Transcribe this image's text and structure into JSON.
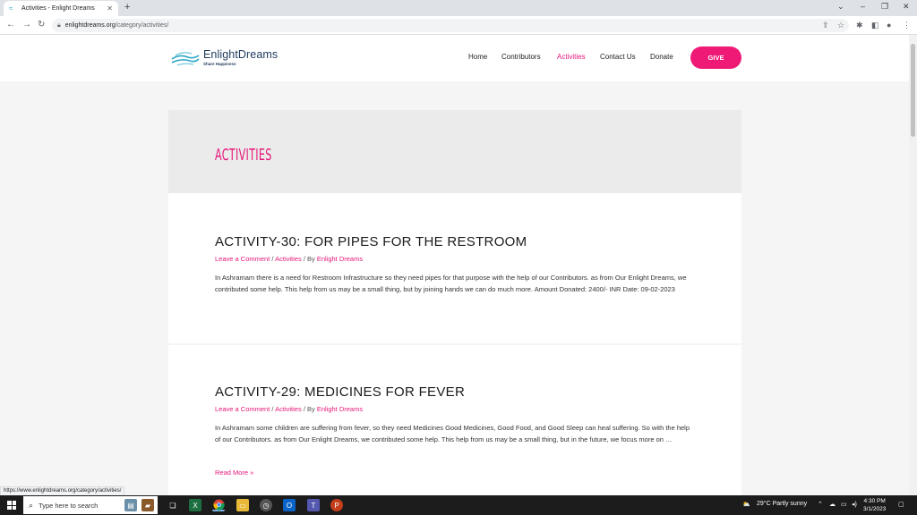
{
  "browser": {
    "tab_title": "Activities - Enlight Dreams",
    "tab_close": "✕",
    "new_tab": "+",
    "url_host": "enlightdreams.org",
    "url_path": "/category/activities/",
    "status_url": "https://www.enlightdreams.org/category/activities/"
  },
  "site": {
    "logo_name": "EnlightDreams",
    "logo_tagline": "Share Happiness",
    "nav": {
      "home": "Home",
      "contributors": "Contributors",
      "activities": "Activities",
      "contact": "Contact Us",
      "donate": "Donate",
      "give": "GIVE"
    },
    "accent_color": "#e6187a"
  },
  "hero": {
    "title": "ACTIVITIES"
  },
  "posts": [
    {
      "title": "ACTIVITY-30: FOR PIPES FOR THE RESTROOM",
      "meta_comment": "Leave a Comment",
      "meta_sep1": " / ",
      "meta_category": "Activities",
      "meta_by": " / By ",
      "meta_author": "Enlight Dreams",
      "excerpt": "In Ashramam there is a need for Restroom Infrastructure so they need pipes for that purpose with the help of our Contributors. as from Our Enlight Dreams, we contributed some help. This help from us may be a small thing, but by joining hands we can do much more. Amount Donated: 2400/- INR Date: 09-02-2023"
    },
    {
      "title": "ACTIVITY-29: MEDICINES FOR FEVER",
      "meta_comment": "Leave a Comment",
      "meta_sep1": " / ",
      "meta_category": "Activities",
      "meta_by": " / By ",
      "meta_author": "Enlight Dreams",
      "excerpt": "In Ashramam some children are suffering from fever, so they need Medicines Good Medicines, Good Food, and Good Sleep can heal suffering. So with the help of our Contributors. as from Our Enlight Dreams, we contributed some help. This help from us may be a small thing, but in the future, we focus more on …",
      "read_more": "Read More »"
    }
  ],
  "taskbar": {
    "search_placeholder": "Type here to search",
    "weather": "29°C  Partly sunny",
    "time": "4:30 PM",
    "date": "3/1/2023"
  }
}
